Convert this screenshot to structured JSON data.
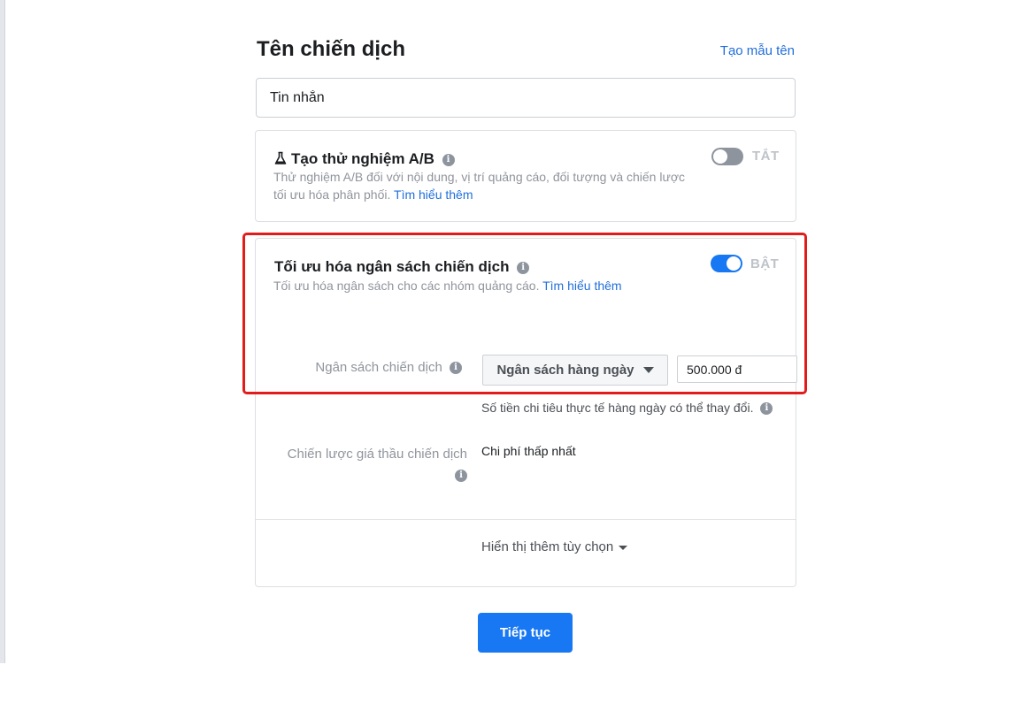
{
  "campaign_name": {
    "title": "Tên chiến dịch",
    "template_link": "Tạo mẫu tên",
    "value": "Tin nhắn"
  },
  "ab_test": {
    "title": "Tạo thử nghiệm A/B",
    "description": "Thử nghiệm A/B đối với nội dung, vị trí quảng cáo, đối tượng và chiến lược tối ưu hóa phân phối.",
    "learn_more": "Tìm hiểu thêm",
    "toggle_label": "TẮT",
    "toggle_on": false
  },
  "budget_optimization": {
    "title": "Tối ưu hóa ngân sách chiến dịch",
    "description": "Tối ưu hóa ngân sách cho các nhóm quảng cáo.",
    "learn_more": "Tìm hiểu thêm",
    "toggle_label": "BẬT",
    "toggle_on": true,
    "budget_label": "Ngân sách chiến dịch",
    "budget_type": "Ngân sách hàng ngày",
    "budget_value": "500.000 đ",
    "budget_note": "Số tiền chi tiêu thực tế hàng ngày có thể thay đổi.",
    "bid_strategy_label": "Chiến lược giá thầu chiến dịch",
    "bid_strategy_value": "Chi phí thấp nhất",
    "more_options": "Hiển thị thêm tùy chọn"
  },
  "actions": {
    "continue": "Tiếp tục"
  },
  "colors": {
    "accent": "#1877f2",
    "link": "#216fdb",
    "highlight": "#e21b1b"
  }
}
